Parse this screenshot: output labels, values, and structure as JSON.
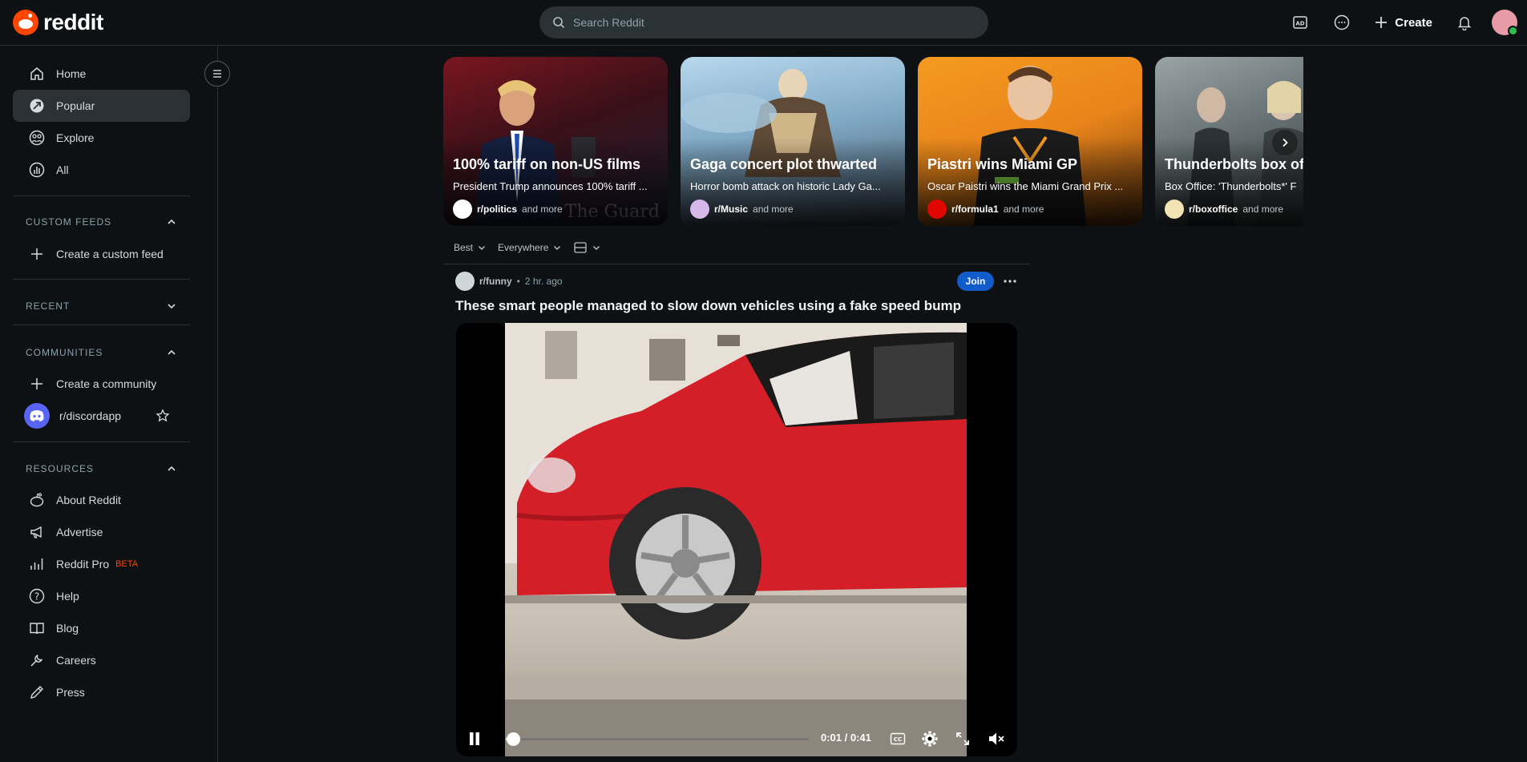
{
  "header": {
    "brand": "reddit",
    "search_placeholder": "Search Reddit",
    "create_label": "Create"
  },
  "sidebar": {
    "nav": [
      {
        "label": "Home",
        "icon": "home-icon"
      },
      {
        "label": "Popular",
        "icon": "popular-icon",
        "active": true
      },
      {
        "label": "Explore",
        "icon": "explore-icon"
      },
      {
        "label": "All",
        "icon": "all-icon"
      }
    ],
    "custom_feeds": {
      "heading": "CUSTOM FEEDS",
      "create_label": "Create a custom feed"
    },
    "recent": {
      "heading": "RECENT"
    },
    "communities": {
      "heading": "COMMUNITIES",
      "create_label": "Create a community",
      "items": [
        {
          "label": "r/discordapp"
        }
      ]
    },
    "resources": {
      "heading": "RESOURCES",
      "items": [
        {
          "label": "About Reddit",
          "icon": "reddit-alien-icon"
        },
        {
          "label": "Advertise",
          "icon": "megaphone-icon"
        },
        {
          "label": "Reddit Pro",
          "icon": "bar-chart-icon",
          "badge": "BETA"
        },
        {
          "label": "Help",
          "icon": "help-icon"
        },
        {
          "label": "Blog",
          "icon": "book-icon"
        },
        {
          "label": "Careers",
          "icon": "wrench-icon"
        },
        {
          "label": "Press",
          "icon": "pencil-icon"
        }
      ]
    }
  },
  "carousel": [
    {
      "title": "100% tariff on non-US films",
      "desc": "President Trump announces 100% tariff ...",
      "sub": "r/politics",
      "more": "and more"
    },
    {
      "title": "Gaga concert plot thwarted",
      "desc": "Horror bomb attack on historic Lady Ga...",
      "sub": "r/Music",
      "more": "and more"
    },
    {
      "title": "Piastri wins Miami GP",
      "desc": "Oscar Paistri wins the Miami Grand Prix ...",
      "sub": "r/formula1",
      "more": "and more"
    },
    {
      "title": "Thunderbolts box of",
      "desc": "Box Office: 'Thunderbolts*' F",
      "sub": "r/boxoffice",
      "more": "and more"
    }
  ],
  "sort": {
    "sort_label": "Best",
    "scope_label": "Everywhere"
  },
  "post": {
    "subreddit": "r/funny",
    "age": "2 hr. ago",
    "join_label": "Join",
    "title": "These smart people managed to slow down vehicles using a fake speed bump",
    "video": {
      "time": "0:01 / 0:41",
      "progress": 0.024
    }
  },
  "colors": {
    "accent": "#ff4500",
    "join": "#115bca",
    "background": "#0e1113"
  }
}
